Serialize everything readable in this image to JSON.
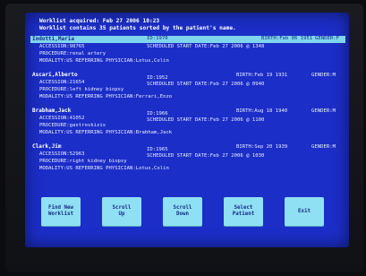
{
  "header": {
    "line1": "Worklist acquired: Feb 27 2006  10:23",
    "line2": "Worklist contains 35 patients sorted by the patient's name."
  },
  "patients": [
    {
      "name": "Iodotti,Maria",
      "id": "ID:1970",
      "birth": "BIRTH:Feb 06 1951",
      "gender": "GENDER:F",
      "accession": "ACCESSION:98765",
      "scheduled": "SCHEDULED START DATE:Feb 27 2006 @ 1348",
      "procedure": "PROCEDURE:renal artery",
      "modality": "MODALITY:US  REFERRING PHYSICIAN:Lotus,Colin"
    },
    {
      "name": "Ascari,Alberto",
      "id": "ID:1952",
      "birth": "BIRTH:Feb 19 1931",
      "gender": "GENDER:M",
      "accession": "ACCESSION:21654",
      "scheduled": "SCHEDULED START DATE:Feb 27 2006 @ 0940",
      "procedure": "PROCEDURE:left kidney biopsy",
      "modality": "MODALITY:US  REFERRING PHYSICIAN:Ferrari,Enzo"
    },
    {
      "name": "Brabham,Jack",
      "id": "ID:1966",
      "birth": "BIRTH:Aug 18 1940",
      "gender": "GENDER:M",
      "accession": "ACCESSION:41052",
      "scheduled": "SCHEDULED START DATE:Feb 27 2006 @ 1100",
      "procedure": "PROCEDURE:gastroskizis",
      "modality": "MODALITY:US  REFERRING PHYSICIAN:Brabham,Jack"
    },
    {
      "name": "Clark,Jim",
      "id": "ID:1965",
      "birth": "BIRTH:Sep 20 1939",
      "gender": "GENDER:M",
      "accession": "ACCESSION:52963",
      "scheduled": "SCHEDULED START DATE:Feb 27 2006 @ 1030",
      "procedure": "PROCEDURE:right kidney biopsy",
      "modality": "MODALITY:US  REFERRING PHYSICIAN:Lotus,Colin"
    }
  ],
  "buttons": {
    "find_new": "Find New\nWorklist",
    "scroll_up": "Scroll\nUp",
    "scroll_down": "Scroll\nDown",
    "select": "Select\nPatient",
    "exit": "Exit"
  }
}
